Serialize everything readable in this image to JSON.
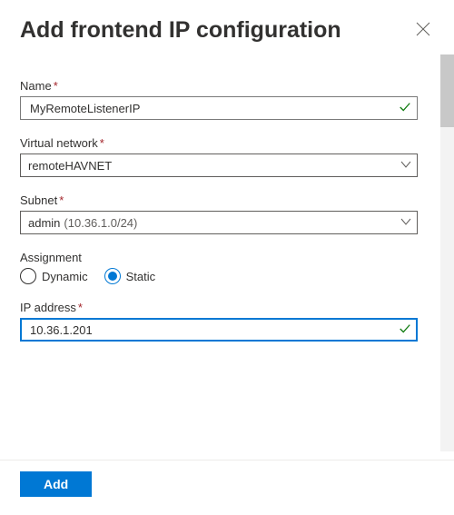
{
  "header": {
    "title": "Add frontend IP configuration"
  },
  "form": {
    "name_label": "Name",
    "name_value": "MyRemoteListenerIP",
    "vnet_label": "Virtual network",
    "vnet_value": "remoteHAVNET",
    "subnet_label": "Subnet",
    "subnet_value": "admin",
    "subnet_range": "(10.36.1.0/24)",
    "assignment_label": "Assignment",
    "assignment_options": {
      "dynamic": "Dynamic",
      "static": "Static"
    },
    "assignment_selected": "static",
    "ip_label": "IP address",
    "ip_value": "10.36.1.201"
  },
  "footer": {
    "add_label": "Add"
  }
}
